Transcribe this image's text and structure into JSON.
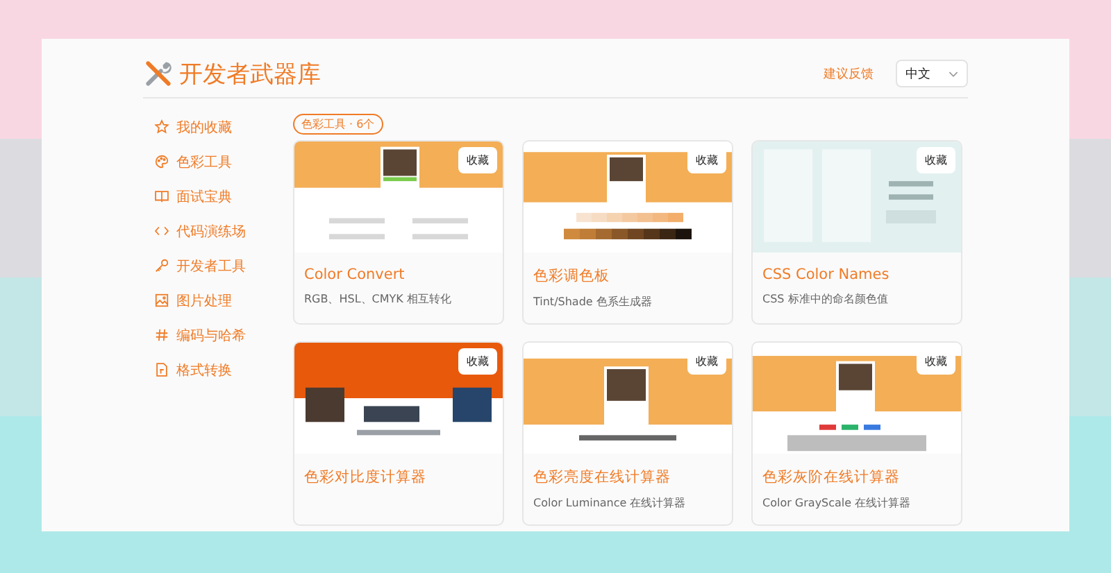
{
  "header": {
    "title": "开发者武器库",
    "feedback": "建议反馈",
    "language": "中文"
  },
  "sidebar": {
    "items": [
      {
        "label": "我的收藏"
      },
      {
        "label": "色彩工具"
      },
      {
        "label": "面试宝典"
      },
      {
        "label": "代码演练场"
      },
      {
        "label": "开发者工具"
      },
      {
        "label": "图片处理"
      },
      {
        "label": "编码与哈希"
      },
      {
        "label": "格式转换"
      }
    ]
  },
  "category_badge": "色彩工具 · 6个",
  "cards": [
    {
      "title": "Color Convert",
      "description": "RGB、HSL、CMYK 相互转化",
      "favorite": "收藏"
    },
    {
      "title": "色彩调色板",
      "description": "Tint/Shade 色系生成器",
      "favorite": "收藏"
    },
    {
      "title": "CSS Color Names",
      "description": "CSS 标准中的命名颜色值",
      "favorite": "收藏"
    },
    {
      "title": "色彩对比度计算器",
      "favorite": "收藏"
    },
    {
      "title": "色彩亮度在线计算器",
      "description": "Color Luminance 在线计算器",
      "favorite": "收藏"
    },
    {
      "title": "色彩灰阶在线计算器",
      "description": "Color GrayScale 在线计算器",
      "favorite": "收藏"
    }
  ]
}
